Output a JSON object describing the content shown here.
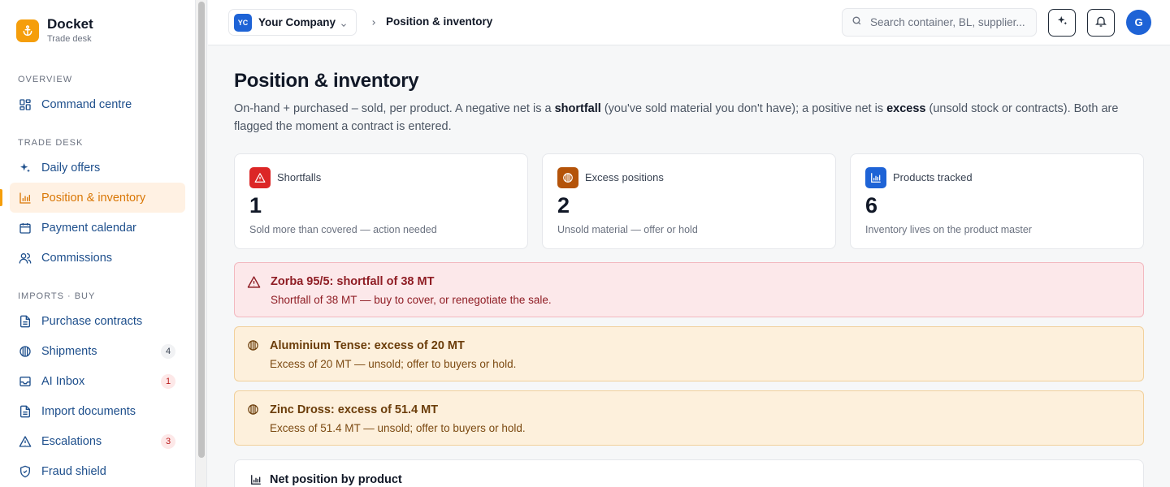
{
  "brand": {
    "name": "Docket",
    "subtitle": "Trade desk"
  },
  "sidebar": {
    "sections": [
      {
        "title": "OVERVIEW",
        "items": [
          {
            "label": "Command centre",
            "icon": "grid-icon"
          }
        ]
      },
      {
        "title": "TRADE DESK",
        "items": [
          {
            "label": "Daily offers",
            "icon": "sparkle-icon"
          },
          {
            "label": "Position & inventory",
            "icon": "bar-chart-icon",
            "active": true
          },
          {
            "label": "Payment calendar",
            "icon": "calendar-icon"
          },
          {
            "label": "Commissions",
            "icon": "users-icon"
          }
        ]
      },
      {
        "title": "IMPORTS · BUY",
        "items": [
          {
            "label": "Purchase contracts",
            "icon": "document-icon"
          },
          {
            "label": "Shipments",
            "icon": "container-icon",
            "badge": "4"
          },
          {
            "label": "AI Inbox",
            "icon": "inbox-icon",
            "badge": "1",
            "badge_color": "red"
          },
          {
            "label": "Import documents",
            "icon": "document-icon"
          },
          {
            "label": "Escalations",
            "icon": "warning-icon",
            "badge": "3",
            "badge_color": "red"
          },
          {
            "label": "Fraud shield",
            "icon": "shield-icon"
          }
        ]
      }
    ]
  },
  "topbar": {
    "company_initials": "YC",
    "company_name": "Your Company",
    "breadcrumb": "Position & inventory",
    "search_placeholder": "Search container, BL, supplier...",
    "avatar_initial": "G"
  },
  "page": {
    "title": "Position & inventory",
    "desc_1": "On-hand + purchased – sold, per product. A negative net is a ",
    "desc_b1": "shortfall",
    "desc_2": " (you've sold material you don't have); a positive net is ",
    "desc_b2": "excess",
    "desc_3": " (unsold stock or contracts). Both are flagged the moment a contract is entered."
  },
  "stats": [
    {
      "label": "Shortfalls",
      "value": "1",
      "help": "Sold more than covered — action needed",
      "icon": "warning-icon",
      "color": "#dc2626"
    },
    {
      "label": "Excess positions",
      "value": "2",
      "help": "Unsold material — offer or hold",
      "icon": "container-icon",
      "color": "#b45309"
    },
    {
      "label": "Products tracked",
      "value": "6",
      "help": "Inventory lives on the product master",
      "icon": "bar-chart-icon",
      "color": "#1e63d6"
    }
  ],
  "alerts": [
    {
      "type": "shortfall",
      "title": "Zorba 95/5: shortfall of 38 MT",
      "text": "Shortfall of 38 MT — buy to cover, or renegotiate the sale."
    },
    {
      "type": "excess",
      "title": "Aluminium Tense: excess of 20 MT",
      "text": "Excess of 20 MT — unsold; offer to buyers or hold."
    },
    {
      "type": "excess",
      "title": "Zinc Dross: excess of 51.4 MT",
      "text": "Excess of 51.4 MT — unsold; offer to buyers or hold."
    }
  ],
  "net_position": {
    "title": "Net position by product"
  }
}
